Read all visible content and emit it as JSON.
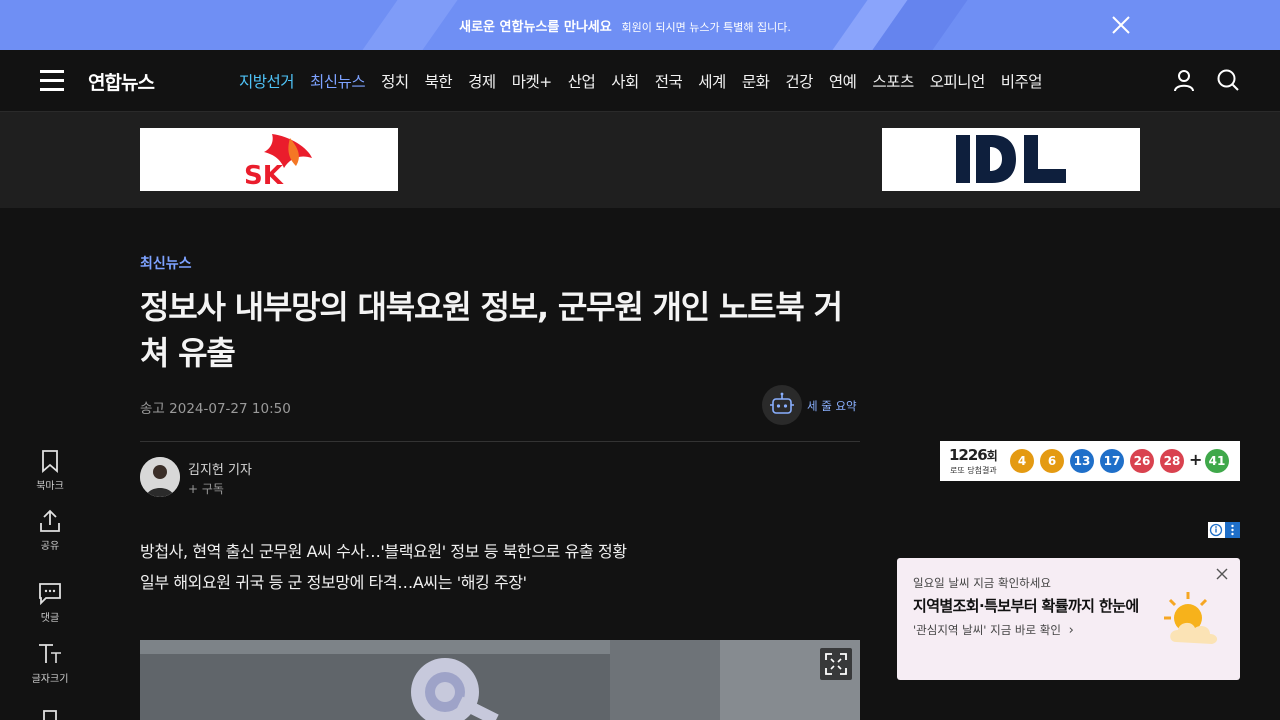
{
  "promo": {
    "title": "새로운 연합뉴스를 만나세요",
    "subtitle": "회원이 되시면 뉴스가 특별해 집니다."
  },
  "nav": {
    "logo": "연합뉴스",
    "items": [
      "지방선거",
      "최신뉴스",
      "정치",
      "북한",
      "경제",
      "마켓+",
      "산업",
      "사회",
      "전국",
      "세계",
      "문화",
      "건강",
      "연예",
      "스포츠",
      "오피니언",
      "비주얼"
    ],
    "highlight_colors": {
      "local_election": "#4fc3f7",
      "latest": "#7da2ff"
    }
  },
  "ads": {
    "left_brand": "SK",
    "right_brand": "DL"
  },
  "article": {
    "section": "최신뉴스",
    "headline": "정보사 내부망의 대북요원 정보, 군무원 개인 노트북 거쳐 유출",
    "date_label": "송고",
    "date": "2024-07-27 10:50",
    "summary_label": "세 줄 요약",
    "reporter": "김지헌 기자",
    "subscribe": "+ 구독",
    "lead": [
      "방첩사, 현역 출신 군무원 A씨 수사…'블랙요원' 정보 등 북한으로 유출 정황",
      "일부 해외요원 귀국 등 군 정보망에 타격…A씨는 '해킹 주장'"
    ]
  },
  "tools": {
    "bookmark": "북마크",
    "share": "공유",
    "comment": "댓글",
    "font_size": "글자크기"
  },
  "lotto": {
    "round": "1226",
    "round_suffix": "회",
    "result_label": "로또 당첨결과",
    "numbers": [
      "4",
      "6",
      "13",
      "17",
      "26",
      "28"
    ],
    "bonus": "41",
    "plus": "+",
    "ball_colors": [
      "#e49a12",
      "#e49a12",
      "#1f6fc9",
      "#1f6fc9",
      "#d9424f",
      "#d9424f"
    ],
    "bonus_color": "#3fa84a"
  },
  "weather_ad": {
    "line1": "일요일 날씨 지금 확인하세요",
    "line2": "지역별조회·특보부터 확률까지 한눈에",
    "line3": "'관심지역 날씨' 지금 바로 확인",
    "chevron": "›"
  }
}
